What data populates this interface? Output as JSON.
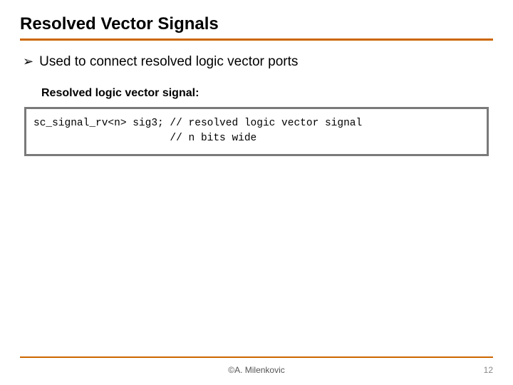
{
  "title": "Resolved Vector Signals",
  "bullet": "Used to connect resolved logic vector ports",
  "subheading": "Resolved logic vector signal:",
  "code": "sc_signal_rv<n> sig3; // resolved logic vector signal\n                      // n bits wide",
  "footer": {
    "author": "©A. Milenkovic",
    "page": "12"
  }
}
